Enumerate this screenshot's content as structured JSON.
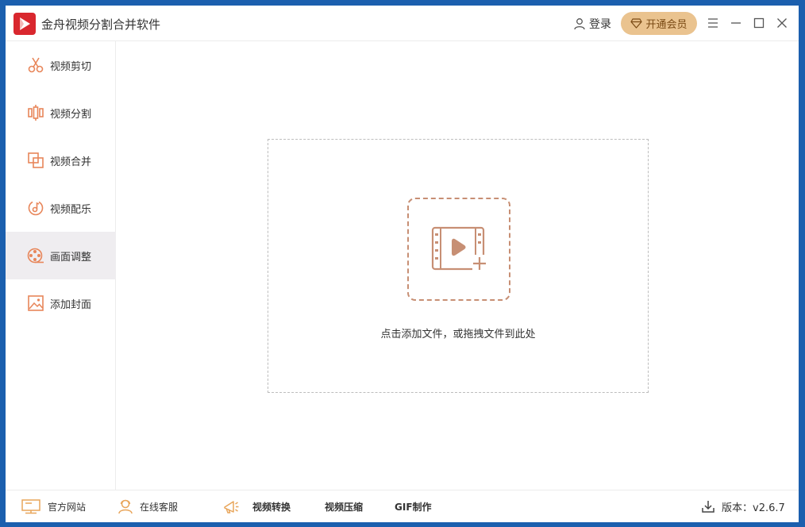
{
  "app": {
    "title": "金舟视频分割合并软件"
  },
  "header": {
    "login_label": "登录",
    "vip_label": "开通会员"
  },
  "sidebar": {
    "items": [
      {
        "label": "视频剪切",
        "icon": "scissors-icon"
      },
      {
        "label": "视频分割",
        "icon": "split-icon"
      },
      {
        "label": "视频合并",
        "icon": "merge-icon"
      },
      {
        "label": "视频配乐",
        "icon": "music-icon"
      },
      {
        "label": "画面调整",
        "icon": "film-reel-icon",
        "active": true
      },
      {
        "label": "添加封面",
        "icon": "image-icon"
      }
    ]
  },
  "main": {
    "drop_hint": "点击添加文件，或拖拽文件到此处"
  },
  "footer": {
    "website_label": "官方网站",
    "support_label": "在线客服",
    "convert_label": "视频转换",
    "compress_label": "视频压缩",
    "gif_label": "GIF制作",
    "version_label": "版本：v2.6.7"
  },
  "colors": {
    "accent": "#e8865a",
    "vip": "#eac38f",
    "brand": "#d9272e",
    "active_bg": "#efedf0"
  }
}
